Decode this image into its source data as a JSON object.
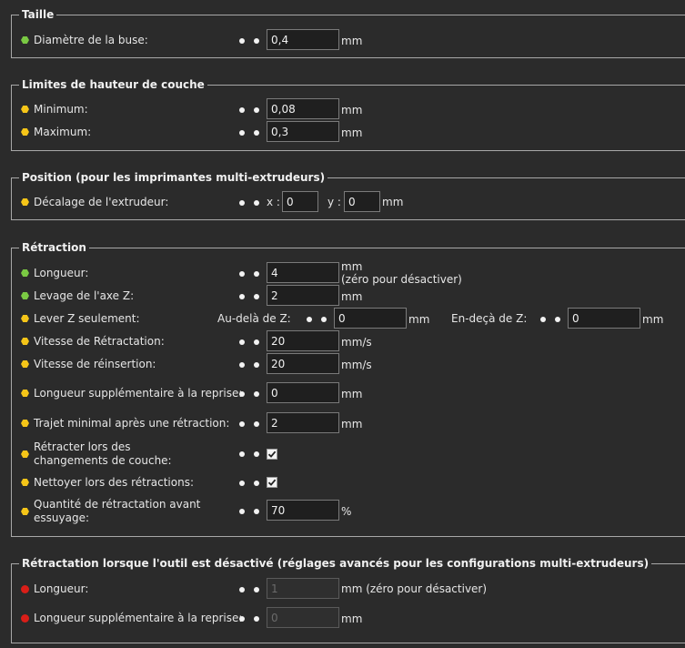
{
  "groups": {
    "taille": {
      "title": "Taille",
      "nozzle": {
        "label": "Diamètre de la buse:",
        "value": "0,4",
        "unit": "mm"
      }
    },
    "limits": {
      "title": "Limites de hauteur de couche",
      "minimum": {
        "label": "Minimum:",
        "value": "0,08",
        "unit": "mm"
      },
      "maximum": {
        "label": "Maximum:",
        "value": "0,3",
        "unit": "mm"
      }
    },
    "position": {
      "title": "Position (pour les imprimantes multi-extrudeurs)",
      "offset": {
        "label": "Décalage de l'extrudeur:",
        "x_label": "x :",
        "x_value": "0",
        "y_label": "y :",
        "y_value": "0",
        "unit": "mm"
      }
    },
    "retraction": {
      "title": "Rétraction",
      "length": {
        "label": "Longueur:",
        "value": "4",
        "unit": "mm",
        "hint": "(zéro pour désactiver)"
      },
      "lift_z": {
        "label": "Levage de l'axe Z:",
        "value": "2",
        "unit": "mm"
      },
      "lift_only": {
        "label": "Lever Z seulement:",
        "above_label": "Au-delà de Z:",
        "above_value": "0",
        "above_unit": "mm",
        "below_label": "En-deçà de Z:",
        "below_value": "0",
        "below_unit": "mm"
      },
      "retract_speed": {
        "label": "Vitesse de Rétractation:",
        "value": "20",
        "unit": "mm/s"
      },
      "deretract_speed": {
        "label": "Vitesse de réinsertion:",
        "value": "20",
        "unit": "mm/s"
      },
      "restart_extra": {
        "label": "Longueur supplémentaire à la reprise:",
        "value": "0",
        "unit": "mm"
      },
      "min_travel": {
        "label": "Trajet minimal après une rétraction:",
        "value": "2",
        "unit": "mm"
      },
      "layer_change": {
        "label": "Rétracter lors des changements de couche:",
        "checked": true
      },
      "wipe": {
        "label": "Nettoyer lors des rétractions:",
        "checked": true
      },
      "before_wipe": {
        "label": "Quantité de rétractation avant essuyage:",
        "value": "70",
        "unit": "%"
      }
    },
    "toolchange": {
      "title": "Rétractation lorsque l'outil est désactivé (réglages avancés pour les configurations multi-extrudeurs)",
      "length": {
        "label": "Longueur:",
        "value": "1",
        "unit": "mm (zéro pour désactiver)"
      },
      "restart_extra": {
        "label": "Longueur supplémentaire à la reprise:",
        "value": "0",
        "unit": "mm"
      }
    }
  },
  "colors": {
    "simple": "#7ac943",
    "advanced": "#f5c518",
    "expert": "#d91e18"
  }
}
